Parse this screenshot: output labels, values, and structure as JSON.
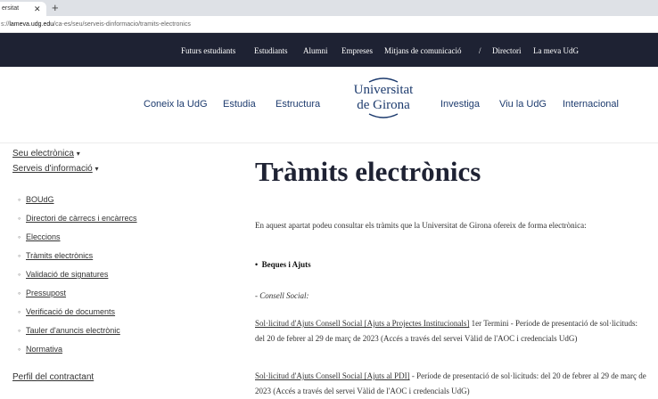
{
  "browser": {
    "tab_title": "ersitat",
    "address": {
      "scheme": "s://",
      "host": "lameva.udg.edu",
      "path": "/ca-es/seu/serveis-dinformacio/tramits-electronics"
    }
  },
  "topnav": {
    "items": [
      "Futurs estudiants",
      "Estudiants",
      "Alumni",
      "Empreses",
      "Mitjans de comunicació",
      "/",
      "Directori",
      "La meva UdG"
    ]
  },
  "mainnav": {
    "left": [
      "Coneix la UdG",
      "Estudia",
      "Estructura"
    ],
    "right": [
      "Investiga",
      "Viu la UdG",
      "Internacional"
    ],
    "logo": {
      "line1": "Universitat",
      "line2": "de Girona"
    }
  },
  "sidebar": {
    "seu": "Seu electrònica",
    "serveis": "Serveis d'informació",
    "caret": "▾",
    "items": [
      "BOUdG",
      "Directori de càrrecs i encàrrecs",
      "Eleccions",
      "Tràmits electrònics",
      "Validació de signatures",
      "Pressupost",
      "Verificació de documents",
      "Tauler d'anuncis electrònic",
      "Normativa"
    ],
    "perfil": "Perfil del contractant"
  },
  "content": {
    "title": "Tràmits electrònics",
    "intro": "En aquest apartat podeu consultar els tràmits que la Universitat de Girona ofereix de forma electrònica:",
    "section": "Beques i Ajuts",
    "subsection": "- Consell Social:",
    "item1_link": "Sol·licitud d'Ajuts Consell Social [Ajuts a Projectes Institucionals]",
    "item1_text": " 1er Termini - Període de presentació de sol·licituds: del 20 de febrer al 29 de març de 2023 (Accés a través del servei Vàlid de l'AOC i credencials UdG)",
    "item2_link": "Sol·licitud d'Ajuts Consell Social [Ajuts al PDI]",
    "item2_text": " - Període de presentació de sol·licituds: del 20 de febrer al 29 de març de 2023 (Accés a través del servei Vàlid de l'AOC i credencials UdG)"
  },
  "colors": {
    "navy": "#1e2233",
    "brand": "#1d3b6e"
  }
}
